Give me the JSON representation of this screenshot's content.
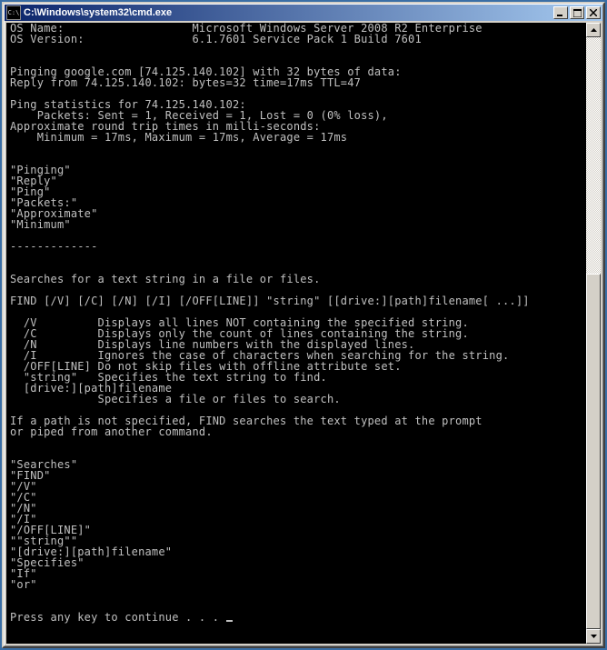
{
  "window": {
    "title": "C:\\Windows\\system32\\cmd.exe",
    "icon_symbol": "C:\\"
  },
  "titlebar_controls": {
    "minimize": "_",
    "maximize": "□",
    "close": "×"
  },
  "console_lines": [
    "OS Name:                   Microsoft Windows Server 2008 R2 Enterprise",
    "OS Version:                6.1.7601 Service Pack 1 Build 7601",
    "",
    "",
    "Pinging google.com [74.125.140.102] with 32 bytes of data:",
    "Reply from 74.125.140.102: bytes=32 time=17ms TTL=47",
    "",
    "Ping statistics for 74.125.140.102:",
    "    Packets: Sent = 1, Received = 1, Lost = 0 (0% loss),",
    "Approximate round trip times in milli-seconds:",
    "    Minimum = 17ms, Maximum = 17ms, Average = 17ms",
    "",
    "",
    "\"Pinging\"",
    "\"Reply\"",
    "\"Ping\"",
    "\"Packets:\"",
    "\"Approximate\"",
    "\"Minimum\"",
    "",
    "-------------",
    "",
    "",
    "Searches for a text string in a file or files.",
    "",
    "FIND [/V] [/C] [/N] [/I] [/OFF[LINE]] \"string\" [[drive:][path]filename[ ...]]",
    "",
    "  /V         Displays all lines NOT containing the specified string.",
    "  /C         Displays only the count of lines containing the string.",
    "  /N         Displays line numbers with the displayed lines.",
    "  /I         Ignores the case of characters when searching for the string.",
    "  /OFF[LINE] Do not skip files with offline attribute set.",
    "  \"string\"   Specifies the text string to find.",
    "  [drive:][path]filename",
    "             Specifies a file or files to search.",
    "",
    "If a path is not specified, FIND searches the text typed at the prompt",
    "or piped from another command.",
    "",
    "",
    "\"Searches\"",
    "\"FIND\"",
    "\"/V\"",
    "\"/C\"",
    "\"/N\"",
    "\"/I\"",
    "\"/OFF[LINE]\"",
    "\"\"string\"\"",
    "\"[drive:][path]filename\"",
    "\"Specifies\"",
    "\"If\"",
    "\"or\"",
    "",
    "",
    "Press any key to continue . . . "
  ],
  "colors": {
    "titlebar_start": "#0a246a",
    "titlebar_end": "#a6caf0",
    "chrome": "#d4d0c8",
    "console_bg": "#000000",
    "console_fg": "#c0c0c0"
  }
}
